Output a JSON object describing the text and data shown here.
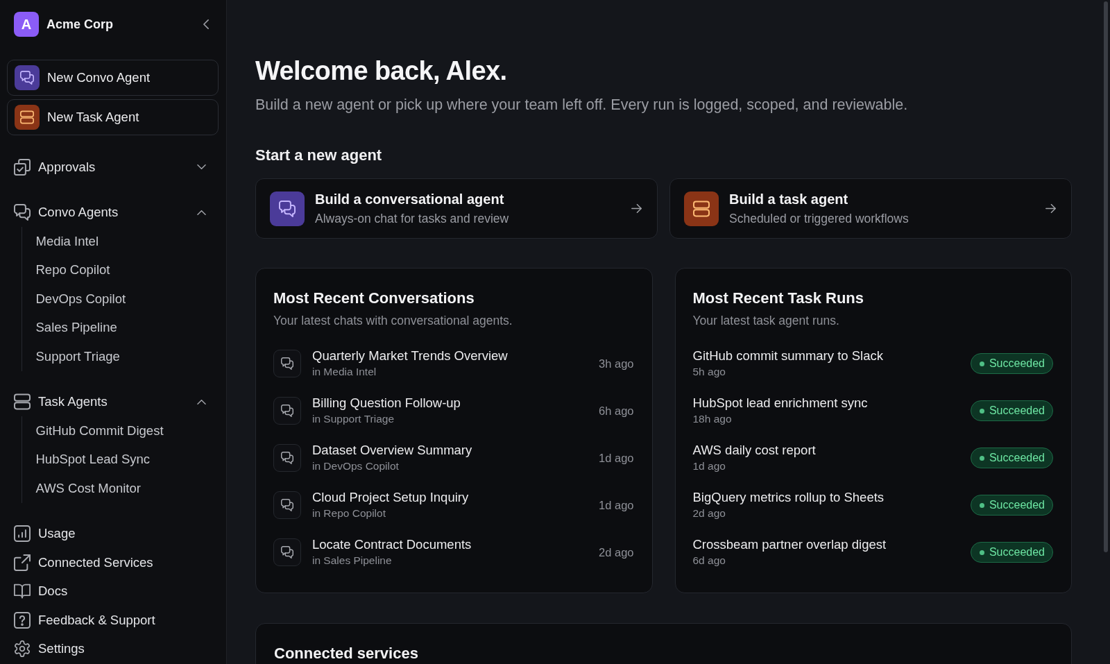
{
  "sidebar": {
    "workspace": {
      "initial": "A",
      "name": "Acme Corp"
    },
    "create_buttons": [
      {
        "kind": "convo",
        "label": "New Convo Agent"
      },
      {
        "kind": "task",
        "label": "New Task Agent"
      }
    ],
    "sections": [
      {
        "label": "Approvals",
        "expanded": false
      },
      {
        "label": "Convo Agents",
        "expanded": true,
        "children": [
          {
            "label": "Media Intel"
          },
          {
            "label": "Repo Copilot"
          },
          {
            "label": "DevOps Copilot"
          },
          {
            "label": "Sales Pipeline"
          },
          {
            "label": "Support Triage"
          }
        ]
      },
      {
        "label": "Task Agents",
        "expanded": true,
        "children": [
          {
            "label": "GitHub Commit Digest"
          },
          {
            "label": "HubSpot Lead Sync"
          },
          {
            "label": "AWS Cost Monitor"
          }
        ]
      }
    ],
    "links": [
      {
        "label": "Usage"
      },
      {
        "label": "Connected Services"
      },
      {
        "label": "Docs"
      },
      {
        "label": "Feedback & Support"
      },
      {
        "label": "Settings"
      }
    ]
  },
  "main": {
    "greeting": "Welcome back, Alex.",
    "intro": "Build a new agent or pick up where your team left off. Every run is logged, scoped, and reviewable.",
    "start_heading": "Start a new agent",
    "agent_cards": [
      {
        "kind": "convo",
        "title": "Build a conversational agent",
        "description": "Always-on chat for tasks and review"
      },
      {
        "kind": "task",
        "title": "Build a task agent",
        "description": "Scheduled or triggered workflows"
      }
    ],
    "conversations": {
      "title": "Most Recent Conversations",
      "subtitle": "Your latest chats with conversational agents.",
      "items": [
        {
          "title": "Quarterly Market Trends Overview",
          "agent": "in Media Intel",
          "time": "3h ago"
        },
        {
          "title": "Billing Question Follow-up",
          "agent": "in Support Triage",
          "time": "6h ago"
        },
        {
          "title": "Dataset Overview Summary",
          "agent": "in DevOps Copilot",
          "time": "1d ago"
        },
        {
          "title": "Cloud Project Setup Inquiry",
          "agent": "in Repo Copilot",
          "time": "1d ago"
        },
        {
          "title": "Locate Contract Documents",
          "agent": "in Sales Pipeline",
          "time": "2d ago"
        }
      ]
    },
    "task_runs": {
      "title": "Most Recent Task Runs",
      "subtitle": "Your latest task agent runs.",
      "items": [
        {
          "title": "GitHub commit summary to Slack",
          "time": "5h ago",
          "status": {
            "kind": "success",
            "label": "Succeeded"
          }
        },
        {
          "title": "HubSpot lead enrichment sync",
          "time": "18h ago",
          "status": {
            "kind": "success",
            "label": "Succeeded"
          }
        },
        {
          "title": "AWS daily cost report",
          "time": "1d ago",
          "status": {
            "kind": "success",
            "label": "Succeeded"
          }
        },
        {
          "title": "BigQuery metrics rollup to Sheets",
          "time": "2d ago",
          "status": {
            "kind": "success",
            "label": "Succeeded"
          }
        },
        {
          "title": "Crossbeam partner overlap digest",
          "time": "6d ago",
          "status": {
            "kind": "success",
            "label": "Succeeded"
          }
        }
      ]
    },
    "connected_services": {
      "title": "Connected services"
    }
  }
}
